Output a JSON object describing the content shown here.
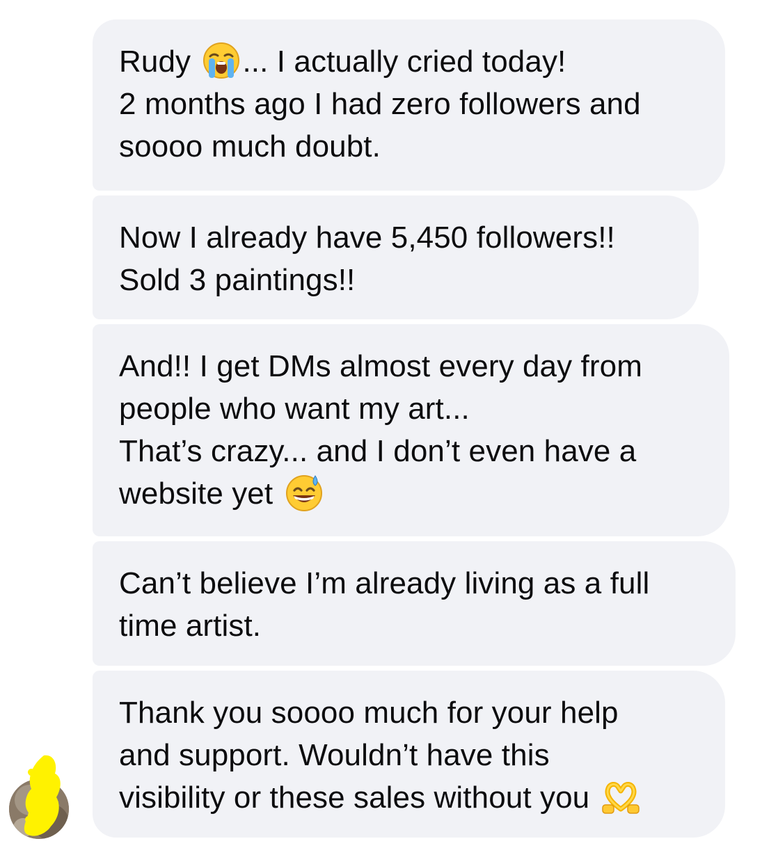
{
  "messages": [
    {
      "lines": [
        {
          "before": "Rudy ",
          "emoji": "loudly-crying-face-emoji",
          "after": "... I actually cried today!"
        },
        {
          "text": "2 months ago I had zero followers and"
        },
        {
          "text": "soooo much doubt."
        }
      ]
    },
    {
      "lines": [
        {
          "text": "Now I already have 5,450 followers!!"
        },
        {
          "text": "Sold 3 paintings!!"
        }
      ]
    },
    {
      "lines": [
        {
          "text": "And!! I get DMs almost every day from"
        },
        {
          "text": "people who want my art..."
        },
        {
          "text": "That’s crazy... and I don’t even have a"
        },
        {
          "before": "website yet ",
          "emoji": "grinning-face-with-sweat-emoji",
          "after": ""
        }
      ]
    },
    {
      "lines": [
        {
          "text": "Can’t believe I’m already living as a full"
        },
        {
          "text": "time artist."
        }
      ]
    },
    {
      "lines": [
        {
          "text": "Thank you soooo much for your help"
        },
        {
          "text": "and support. Wouldn’t have this"
        },
        {
          "before": "visibility or these sales without you ",
          "emoji": "heart-hands-emoji",
          "after": ""
        }
      ]
    }
  ],
  "colors": {
    "bubble_background": "#f1f2f6",
    "text": "#0c0c0e",
    "scribble": "#fff200"
  }
}
